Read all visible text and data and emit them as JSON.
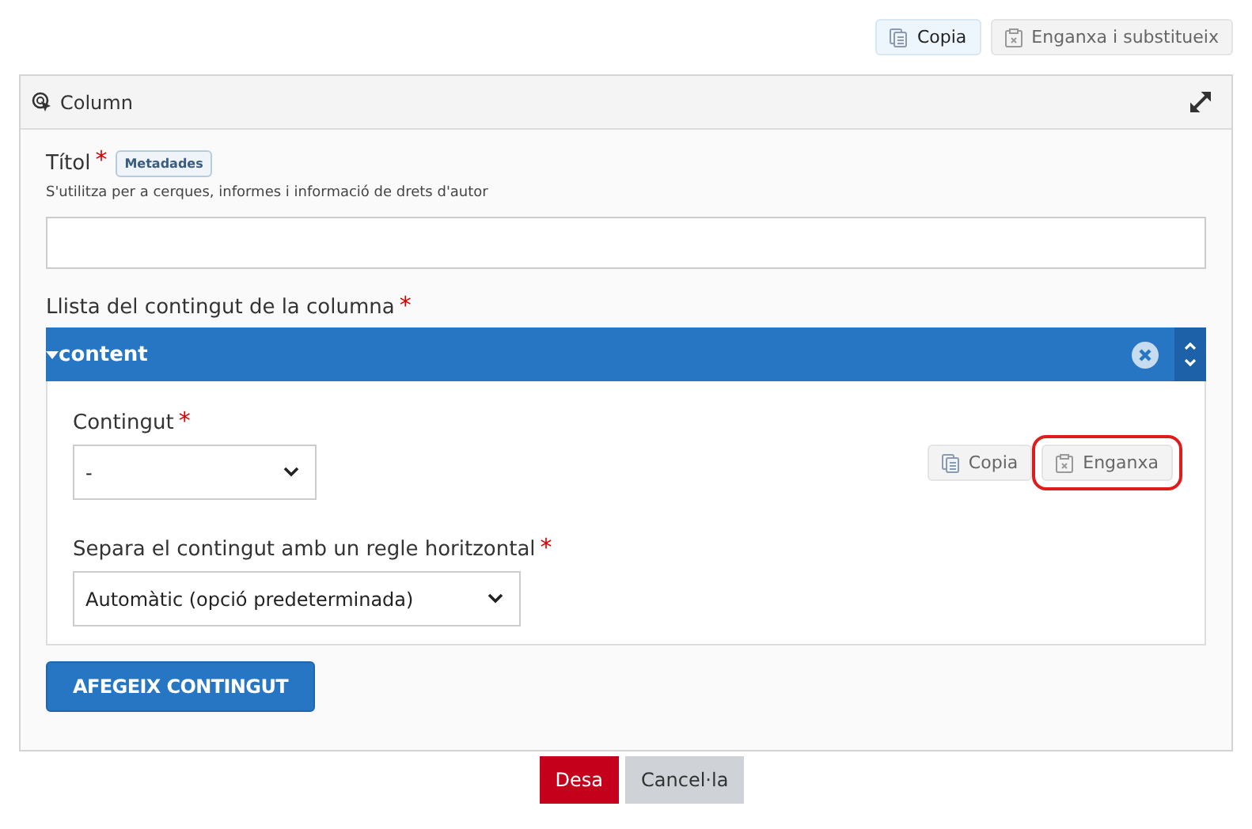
{
  "toolbar": [
    {
      "label": "Copia",
      "kind": "copy",
      "active": true
    },
    {
      "label": "Enganxa i substitueix",
      "kind": "paste",
      "active": false
    }
  ],
  "panel": {
    "title": "Column",
    "title_field": {
      "label": "Títol",
      "required_mark": "*",
      "badge": "Metadades",
      "help": "S'utilitza per a cerques, informes i informació de drets d'autor"
    },
    "list": {
      "label": "Llista del contingut de la columna",
      "required_mark": "*",
      "items": [
        {
          "title": "content",
          "expanded": true,
          "buttons": [
            {
              "label": "Copia",
              "kind": "copy",
              "highlighted": false
            },
            {
              "label": "Enganxa",
              "kind": "paste",
              "highlighted": true
            }
          ],
          "fields": [
            {
              "label": "Contingut",
              "required_mark": "*",
              "value": "-"
            },
            {
              "label": "Separa el contingut amb un regle horitzontal",
              "required_mark": "*",
              "value": "Automàtic (opció predeterminada)"
            }
          ]
        }
      ],
      "add_button": "AFEGEIX CONTINGUT"
    }
  },
  "footer": {
    "save": "Desa",
    "cancel": "Cancel·la"
  }
}
